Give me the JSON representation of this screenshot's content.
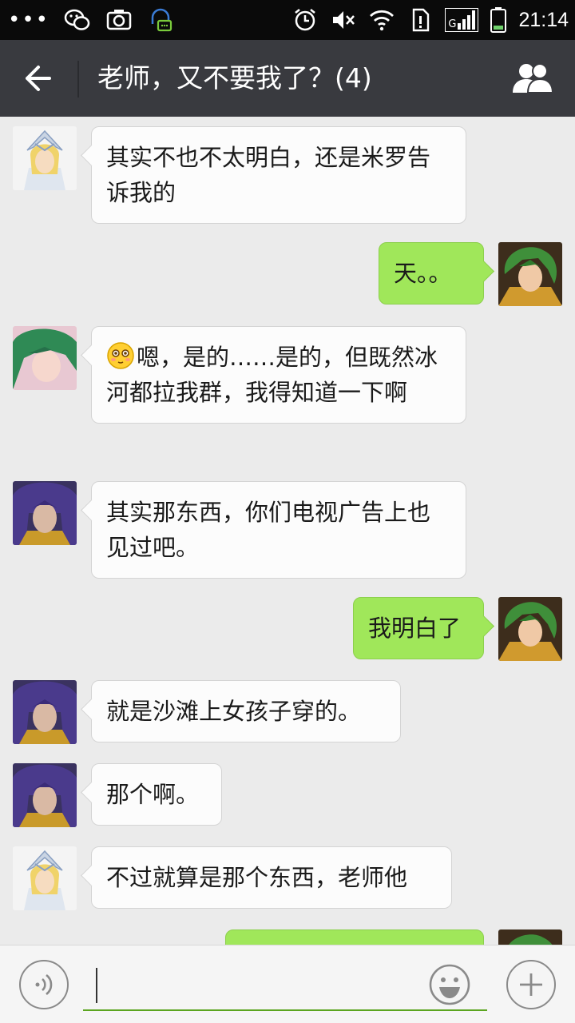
{
  "status_bar": {
    "dots": "•••",
    "time": "21:14",
    "signal_label": "G"
  },
  "header": {
    "title": "老师，又不要我了？(4)",
    "back_icon": "arrow-left-icon",
    "members_icon": "group-members-icon"
  },
  "messages": [
    {
      "direction": "in",
      "sender": "hyoga",
      "text": "其实不也不太明白，还是米罗告诉我的"
    },
    {
      "direction": "out",
      "sender": "me",
      "text": "天。。"
    },
    {
      "direction": "in",
      "sender": "shun",
      "text": "嗯，是的……是的，但既然冰河都拉我群，我得知道一下啊",
      "emoji": "shy-face-emoji"
    },
    {
      "direction": "in",
      "sender": "camus",
      "text": "其实那东西，你们电视广告上也见过吧。"
    },
    {
      "direction": "out",
      "sender": "me",
      "text": "我明白了"
    },
    {
      "direction": "in",
      "sender": "camus",
      "text": "就是沙滩上女孩子穿的。"
    },
    {
      "direction": "in",
      "sender": "camus",
      "text": "那个啊。"
    },
    {
      "direction": "in",
      "sender": "hyoga",
      "text": "不过就算是那个东西，老师他"
    }
  ],
  "input_bar": {
    "voice_icon": "voice-icon",
    "emoji_icon": "smiley-icon",
    "plus_icon": "plus-icon",
    "text_value": ""
  },
  "colors": {
    "header_bg": "#393a3f",
    "chat_bg": "#ebebeb",
    "outgoing_bubble": "#a0e75a",
    "incoming_bubble": "#fcfcfc",
    "input_underline": "#5ba51f"
  }
}
